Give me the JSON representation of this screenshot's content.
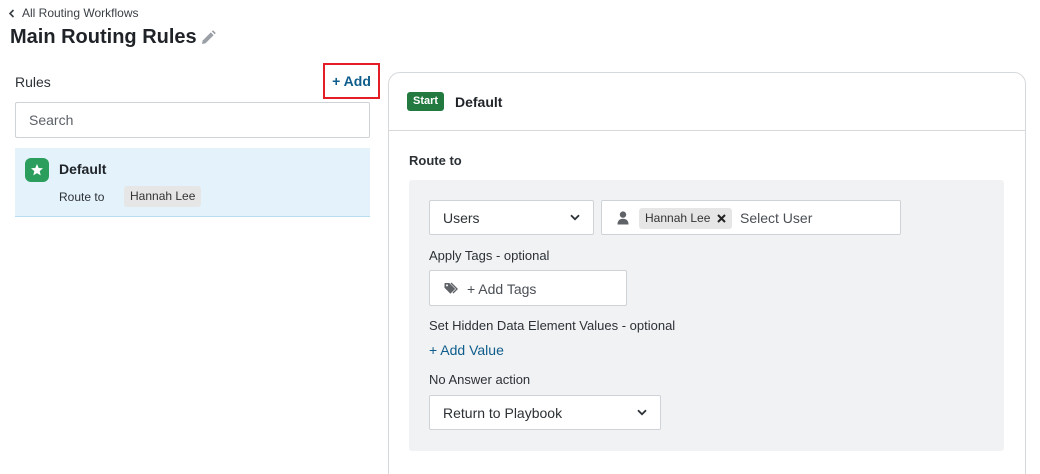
{
  "nav": {
    "back_label": "All Routing Workflows"
  },
  "page": {
    "title": "Main Routing Rules"
  },
  "rules": {
    "label": "Rules",
    "add_label": "+ Add",
    "search_placeholder": "Search",
    "items": [
      {
        "name": "Default",
        "route_label": "Route to",
        "user": "Hannah Lee"
      }
    ]
  },
  "panel": {
    "badge": "Start",
    "title": "Default",
    "route_label": "Route to",
    "route_type": "Users",
    "selected_user": "Hannah Lee",
    "user_placeholder": "Select User",
    "tags_label": "Apply Tags - optional",
    "tags_placeholder": "+ Add Tags",
    "hidden_label": "Set Hidden Data Element Values - optional",
    "add_value_label": "+ Add Value",
    "no_answer_label": "No Answer action",
    "no_answer_value": "Return to Playbook"
  },
  "icons": {
    "back": "chevron-left-icon",
    "edit": "pencil-icon",
    "rule": "star-icon",
    "user": "person-icon",
    "remove": "close-icon",
    "tags": "tags-icon",
    "dropdown": "chevron-down-icon"
  },
  "colors": {
    "accent_link": "#0f5d8c",
    "start_badge": "#237a41",
    "rule_icon": "#2b9e5d",
    "selected_rule_bg": "#e3f2fb",
    "highlight_box": "#e41e26"
  }
}
